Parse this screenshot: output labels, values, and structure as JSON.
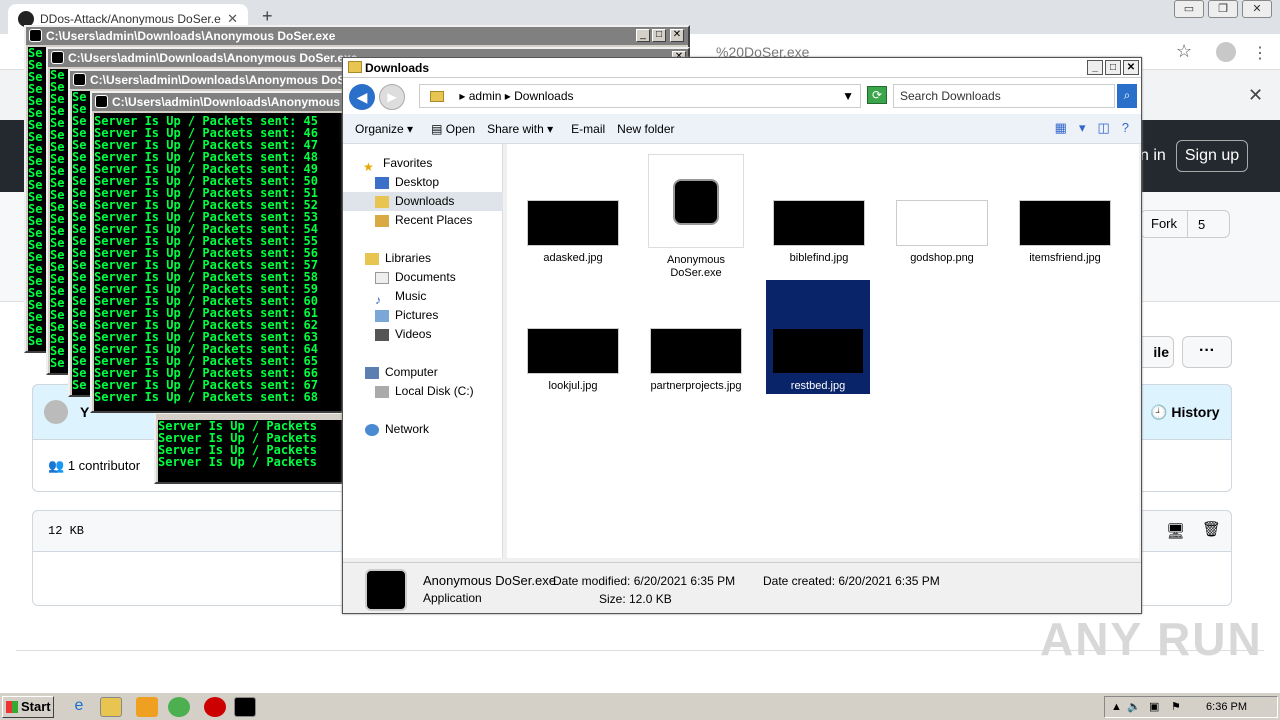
{
  "browser": {
    "tab_title": "DDos-Attack/Anonymous DoSer.exe",
    "new_tab": "+",
    "url_fragment": "%20DoSer.exe",
    "window_controls": [
      "▭",
      "❐",
      "✕"
    ]
  },
  "github": {
    "signin": "n in",
    "signup": "Sign up",
    "fork_label": "Fork",
    "fork_count": "5",
    "file_button": "ile",
    "more_button": "···",
    "author_initial": "Y",
    "history": "History",
    "contributors": "1 contributor",
    "file_size": "12 KB"
  },
  "consoles": [
    {
      "title": "C:\\Users\\admin\\Downloads\\Anonymous DoSer.exe",
      "lines": [
        "Se",
        "Se",
        "Se",
        "Se",
        "Se",
        "Se",
        "Se",
        "Se",
        "Se",
        "Se",
        "Se",
        "Se",
        "Se",
        "Se",
        "Se",
        "Se",
        "Se",
        "Se",
        "Se",
        "Se",
        "Se",
        "Se",
        "Se",
        "Se",
        "Se"
      ]
    },
    {
      "title": "C:\\Users\\admin\\Downloads\\Anonymous DoSer.exe",
      "lines": [
        "Se",
        "Se",
        "Se",
        "Se",
        "Se",
        "Se",
        "Se",
        "Se",
        "Se",
        "Se",
        "Se",
        "Se",
        "Se",
        "Se",
        "Se",
        "Se",
        "Se",
        "Se",
        "Se",
        "Se",
        "Se",
        "Se",
        "Se",
        "Se",
        "Se"
      ]
    },
    {
      "title": "C:\\Users\\admin\\Downloads\\Anonymous DoSer.exe",
      "lines": [
        "Se",
        "Se",
        "Se",
        "Se",
        "Se",
        "Se",
        "Se",
        "Se",
        "Se",
        "Se",
        "Se",
        "Se",
        "Se",
        "Se",
        "Se",
        "Se",
        "Se",
        "Se",
        "Se",
        "Se",
        "Se",
        "Se",
        "Se",
        "Se",
        "Se"
      ]
    },
    {
      "title": "C:\\Users\\admin\\Downloads\\Anonymous DoSer.exe",
      "lines": [
        "Server Is Up / Packets sent: 45",
        "Server Is Up / Packets sent: 46",
        "Server Is Up / Packets sent: 47",
        "Server Is Up / Packets sent: 48",
        "Server Is Up / Packets sent: 49",
        "Server Is Up / Packets sent: 50",
        "Server Is Up / Packets sent: 51",
        "Server Is Up / Packets sent: 52",
        "Server Is Up / Packets sent: 53",
        "Server Is Up / Packets sent: 54",
        "Server Is Up / Packets sent: 55",
        "Server Is Up / Packets sent: 56",
        "Server Is Up / Packets sent: 57",
        "Server Is Up / Packets sent: 58",
        "Server Is Up / Packets sent: 59",
        "Server Is Up / Packets sent: 60",
        "Server Is Up / Packets sent: 61",
        "Server Is Up / Packets sent: 62",
        "Server Is Up / Packets sent: 63",
        "Server Is Up / Packets sent: 64",
        "Server Is Up / Packets sent: 65",
        "Server Is Up / Packets sent: 66",
        "Server Is Up / Packets sent: 67",
        "Server Is Up / Packets sent: 68"
      ]
    },
    {
      "title": "",
      "lines": [
        "Server Is Up / Packets",
        "Server Is Up / Packets",
        "Server Is Up / Packets",
        "Server Is Up / Packets"
      ]
    }
  ],
  "explorer": {
    "title": "Downloads",
    "breadcrumb": [
      "admin",
      "Downloads"
    ],
    "search_placeholder": "Search Downloads",
    "commands": [
      "Organize ▾",
      "Open",
      "Share with ▾",
      "E-mail",
      "New folder"
    ],
    "nav": {
      "favorites": "Favorites",
      "desktop": "Desktop",
      "downloads": "Downloads",
      "recent": "Recent Places",
      "libraries": "Libraries",
      "documents": "Documents",
      "music": "Music",
      "pictures": "Pictures",
      "videos": "Videos",
      "computer": "Computer",
      "localdisk": "Local Disk (C:)",
      "network": "Network"
    },
    "files": [
      "adasked.jpg",
      "Anonymous DoSer.exe",
      "biblefind.jpg",
      "godshop.png",
      "itemsfriend.jpg",
      "lookjul.jpg",
      "partnerprojects.jpg",
      "restbed.jpg"
    ],
    "details": {
      "name": "Anonymous DoSer.exe",
      "type": "Application",
      "date_modified": "Date modified: 6/20/2021 6:35 PM",
      "size": "Size: 12.0 KB",
      "date_created": "Date created: 6/20/2021 6:35 PM"
    }
  },
  "taskbar": {
    "start": "Start",
    "clock": "6:36 PM"
  },
  "watermark": "ANY RUN"
}
